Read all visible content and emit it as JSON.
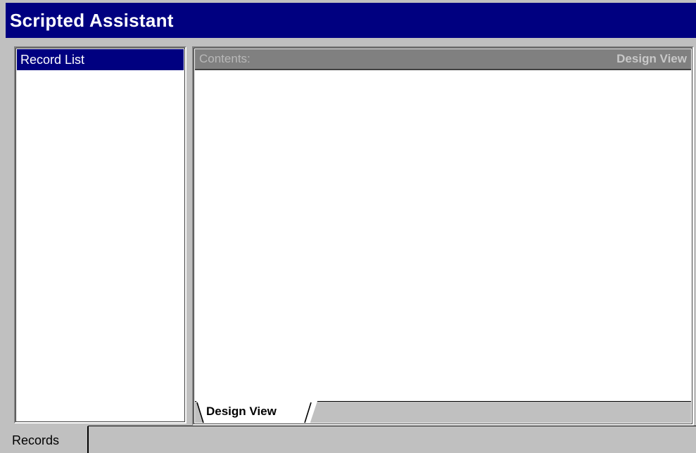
{
  "window": {
    "title": "Scripted Assistant",
    "title_bar_color": "#000080"
  },
  "left_panel": {
    "header": "Record List",
    "header_color": "#000080",
    "items": []
  },
  "right_panel": {
    "header_label": "Contents:",
    "header_view": "Design View",
    "header_color": "#808080",
    "tabs": [
      {
        "label": "Design View",
        "active": true
      }
    ]
  },
  "bottom_bar": {
    "tabs": [
      {
        "label": "Records",
        "active": true
      }
    ]
  }
}
